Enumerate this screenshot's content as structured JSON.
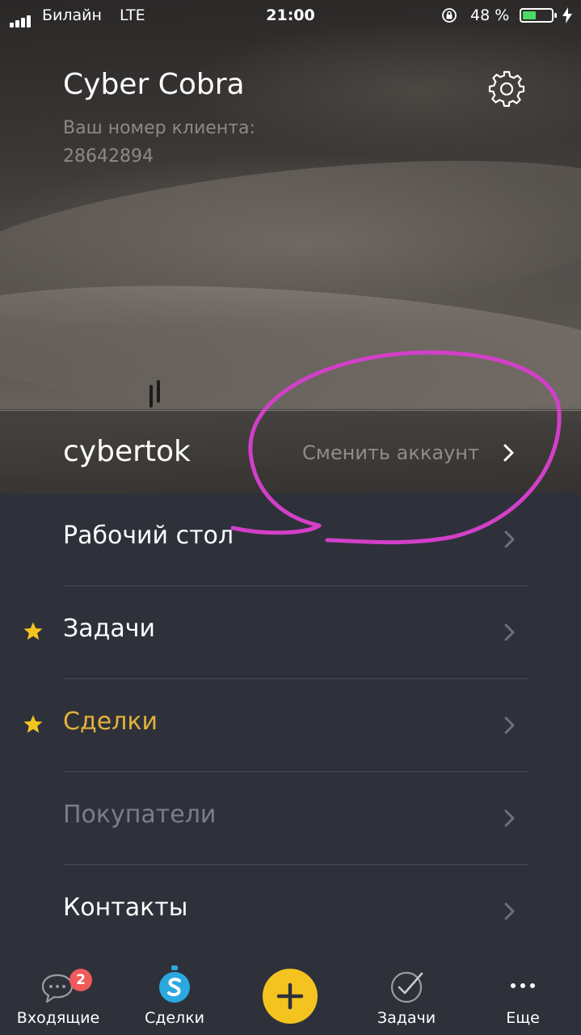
{
  "status_bar": {
    "carrier": "Билайн",
    "network": "LTE",
    "time": "21:00",
    "battery_percent": "48 %",
    "battery_level": 0.48,
    "battery_color": "#4cd964"
  },
  "profile": {
    "name": "Cyber Cobra",
    "client_label": "Ваш номер клиента:",
    "client_number": "28642894",
    "settings_icon": "gear-icon"
  },
  "account": {
    "name": "cybertok",
    "switch_label": "Сменить аккаунт",
    "chevron_icon": "chevron-right-icon"
  },
  "menu": {
    "items": [
      {
        "label": "Рабочий стол",
        "starred": false,
        "state": "normal"
      },
      {
        "label": "Задачи",
        "starred": true,
        "state": "normal"
      },
      {
        "label": "Сделки",
        "starred": true,
        "state": "active"
      },
      {
        "label": "Покупатели",
        "starred": false,
        "state": "disabled"
      },
      {
        "label": "Контакты",
        "starred": false,
        "state": "normal"
      }
    ],
    "star_color": "#f4c320",
    "active_color": "#e3b23c"
  },
  "annotation": {
    "type": "hand-drawn circle",
    "color": "#d23fc8"
  },
  "tab_bar": {
    "tabs": [
      {
        "label": "Входящие",
        "icon": "chat-bubble-icon",
        "badge": "2"
      },
      {
        "label": "Сделки",
        "icon": "deals-dollar-icon"
      },
      {
        "label": "",
        "icon": "plus-icon"
      },
      {
        "label": "Задачи",
        "icon": "checkmark-circle-icon"
      },
      {
        "label": "Еще",
        "icon": "more-dots-icon"
      }
    ],
    "fab_color": "#f4c320",
    "badge_color": "#ef5a5a"
  }
}
